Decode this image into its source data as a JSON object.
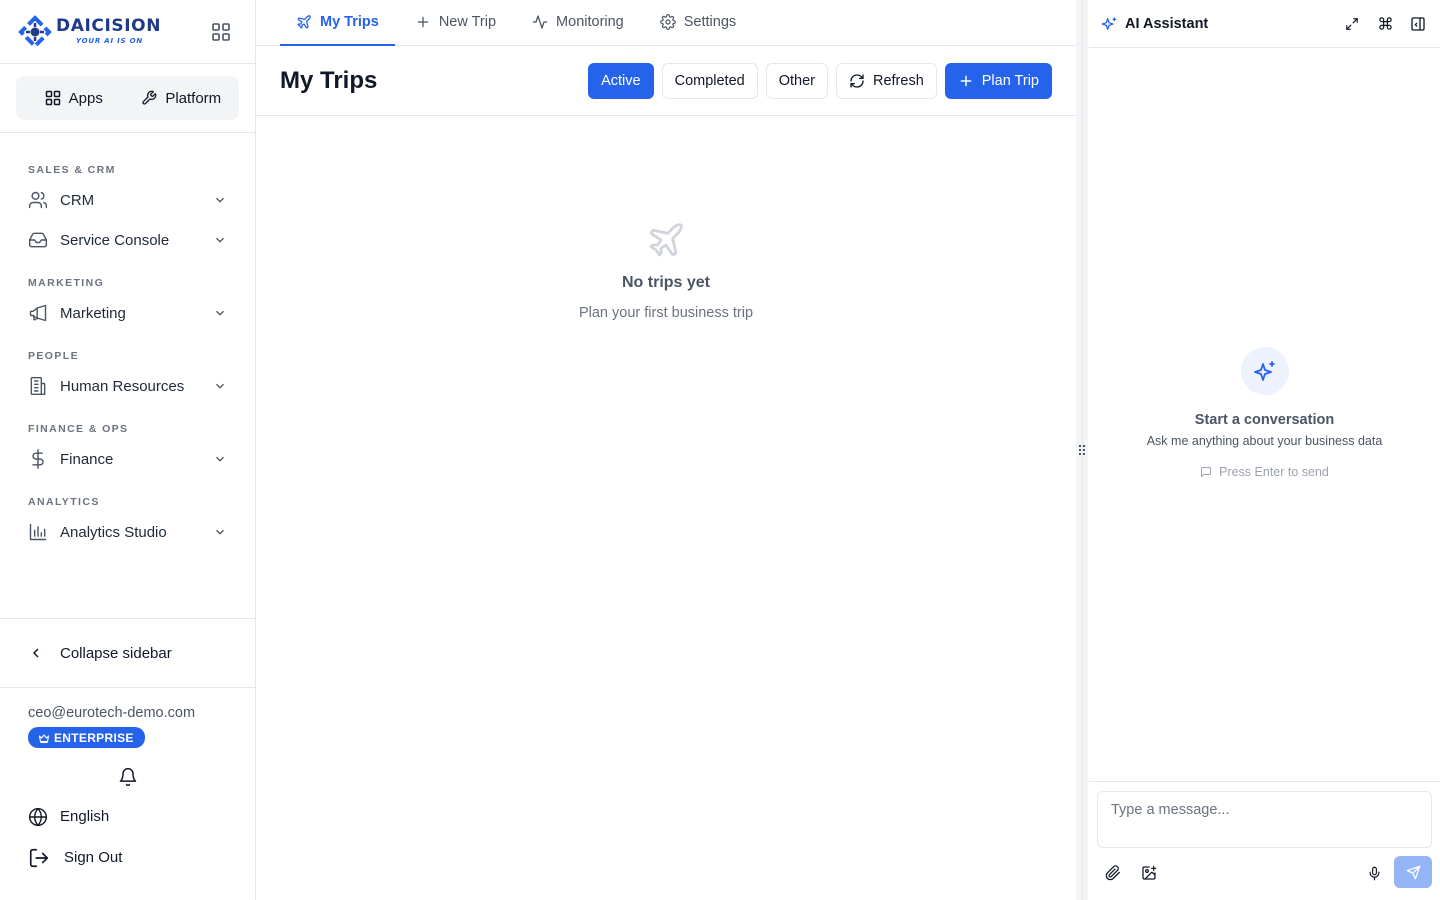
{
  "brand": {
    "name": "DAICISION",
    "tagline": "YOUR AI IS ON",
    "primary_color": "#2563eb",
    "dark_color": "#1e3a8a"
  },
  "sidebar": {
    "switcher": [
      {
        "label": "Apps",
        "icon": "grid-icon"
      },
      {
        "label": "Platform",
        "icon": "wrench-icon"
      }
    ],
    "sections": [
      {
        "label": "SALES & CRM",
        "items": [
          {
            "label": "CRM",
            "icon": "users-icon"
          },
          {
            "label": "Service Console",
            "icon": "inbox-icon"
          }
        ]
      },
      {
        "label": "MARKETING",
        "items": [
          {
            "label": "Marketing",
            "icon": "megaphone-icon"
          }
        ]
      },
      {
        "label": "PEOPLE",
        "items": [
          {
            "label": "Human Resources",
            "icon": "building-icon"
          }
        ]
      },
      {
        "label": "FINANCE & OPS",
        "items": [
          {
            "label": "Finance",
            "icon": "dollar-icon"
          }
        ]
      },
      {
        "label": "ANALYTICS",
        "items": [
          {
            "label": "Analytics Studio",
            "icon": "bar-chart-icon"
          }
        ]
      }
    ],
    "collapse_label": "Collapse sidebar",
    "user": {
      "email": "ceo@eurotech-demo.com",
      "plan": "ENTERPRISE"
    },
    "language": "English",
    "sign_out": "Sign Out"
  },
  "main": {
    "tabs": [
      {
        "label": "My Trips",
        "icon": "plane-icon",
        "active": true
      },
      {
        "label": "New Trip",
        "icon": "plus-icon",
        "active": false
      },
      {
        "label": "Monitoring",
        "icon": "activity-icon",
        "active": false
      },
      {
        "label": "Settings",
        "icon": "gear-icon",
        "active": false
      }
    ],
    "title": "My Trips",
    "filters": {
      "active": "Active",
      "completed": "Completed",
      "other": "Other"
    },
    "refresh": "Refresh",
    "plan_trip": "Plan Trip",
    "empty": {
      "title": "No trips yet",
      "subtitle": "Plan your first business trip"
    }
  },
  "assistant": {
    "title": "AI Assistant",
    "start_title": "Start a conversation",
    "start_subtitle": "Ask me anything about your business data",
    "hint": "Press Enter to send",
    "input_placeholder": "Type a message..."
  }
}
